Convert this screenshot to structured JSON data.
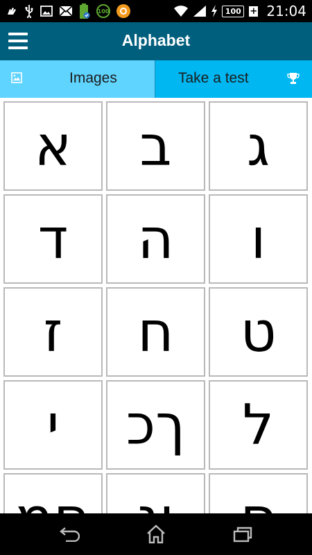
{
  "status_bar": {
    "time": "21:04",
    "battery": "100",
    "badge_text": "100",
    "icons": [
      "hand-icon",
      "usb-icon",
      "image-icon",
      "mail-icon",
      "battery-app-icon",
      "badge-100-icon",
      "orange-app-icon",
      "wifi-icon",
      "signal-icon",
      "charging-icon",
      "battery-icon",
      "battery-plus-icon"
    ]
  },
  "app_bar": {
    "title": "Alphabet"
  },
  "tabs": [
    {
      "label": "Images",
      "icon": "image-icon",
      "selected": true
    },
    {
      "label": "Take a test",
      "icon": "trophy-icon",
      "selected": false
    }
  ],
  "letters": [
    "א",
    "ב",
    "ג",
    "ד",
    "ה",
    "ו",
    "ז",
    "ח",
    "ט",
    "י",
    "ךכ",
    "ל",
    "םמ",
    "ןנ",
    "ס"
  ],
  "colors": {
    "app_bar": "#005f7d",
    "tab_selected": "#5fd4ff",
    "tab_unselected": "#00b7f1",
    "tile_border": "#b8b8b8"
  },
  "nav_bar": {
    "icons": [
      "back-icon",
      "home-icon",
      "recent-apps-icon"
    ]
  }
}
